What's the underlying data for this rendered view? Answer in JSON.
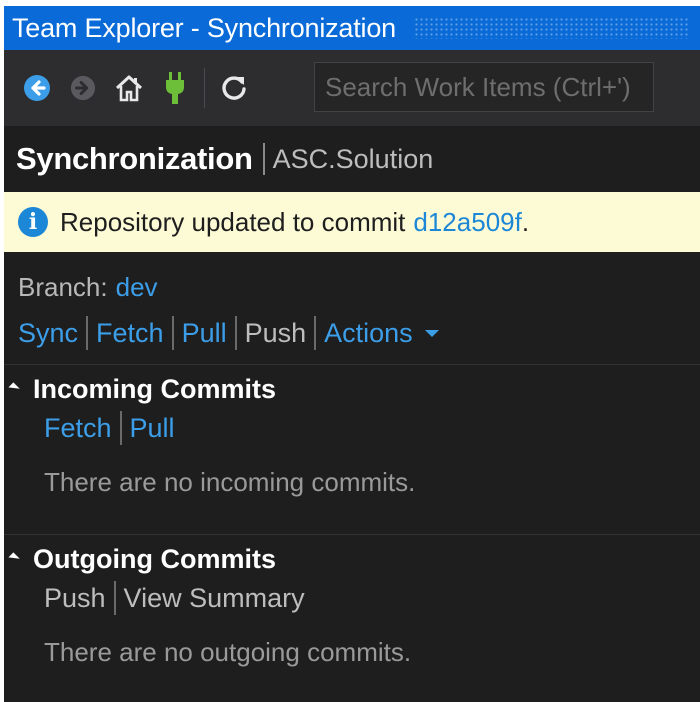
{
  "window": {
    "title": "Team Explorer - Synchronization"
  },
  "toolbar": {
    "buttons": [
      {
        "icon": "back-arrow-icon"
      },
      {
        "icon": "forward-arrow-icon"
      },
      {
        "icon": "home-icon"
      },
      {
        "icon": "connect-plug-icon"
      },
      {
        "icon": "refresh-icon"
      }
    ],
    "search_placeholder": "Search Work Items (Ctrl+')"
  },
  "header": {
    "title": "Synchronization",
    "context": "ASC.Solution"
  },
  "info": {
    "message": "Repository updated to commit ",
    "commit": "d12a509f",
    "suffix": "."
  },
  "branch": {
    "label": "Branch:",
    "name": "dev"
  },
  "actions": {
    "sync": "Sync",
    "fetch": "Fetch",
    "pull": "Pull",
    "push": "Push",
    "more": "Actions"
  },
  "incoming": {
    "title": "Incoming Commits",
    "fetch": "Fetch",
    "pull": "Pull",
    "empty": "There are no incoming commits."
  },
  "outgoing": {
    "title": "Outgoing Commits",
    "push": "Push",
    "view_summary": "View Summary",
    "empty": "There are no outgoing commits."
  },
  "colors": {
    "accent": "#0a6bd8",
    "link": "#3c9ee8",
    "info_bg": "#fdfbd5",
    "panel_bg": "#1e1e1e",
    "connected": "#6dbf3a"
  }
}
